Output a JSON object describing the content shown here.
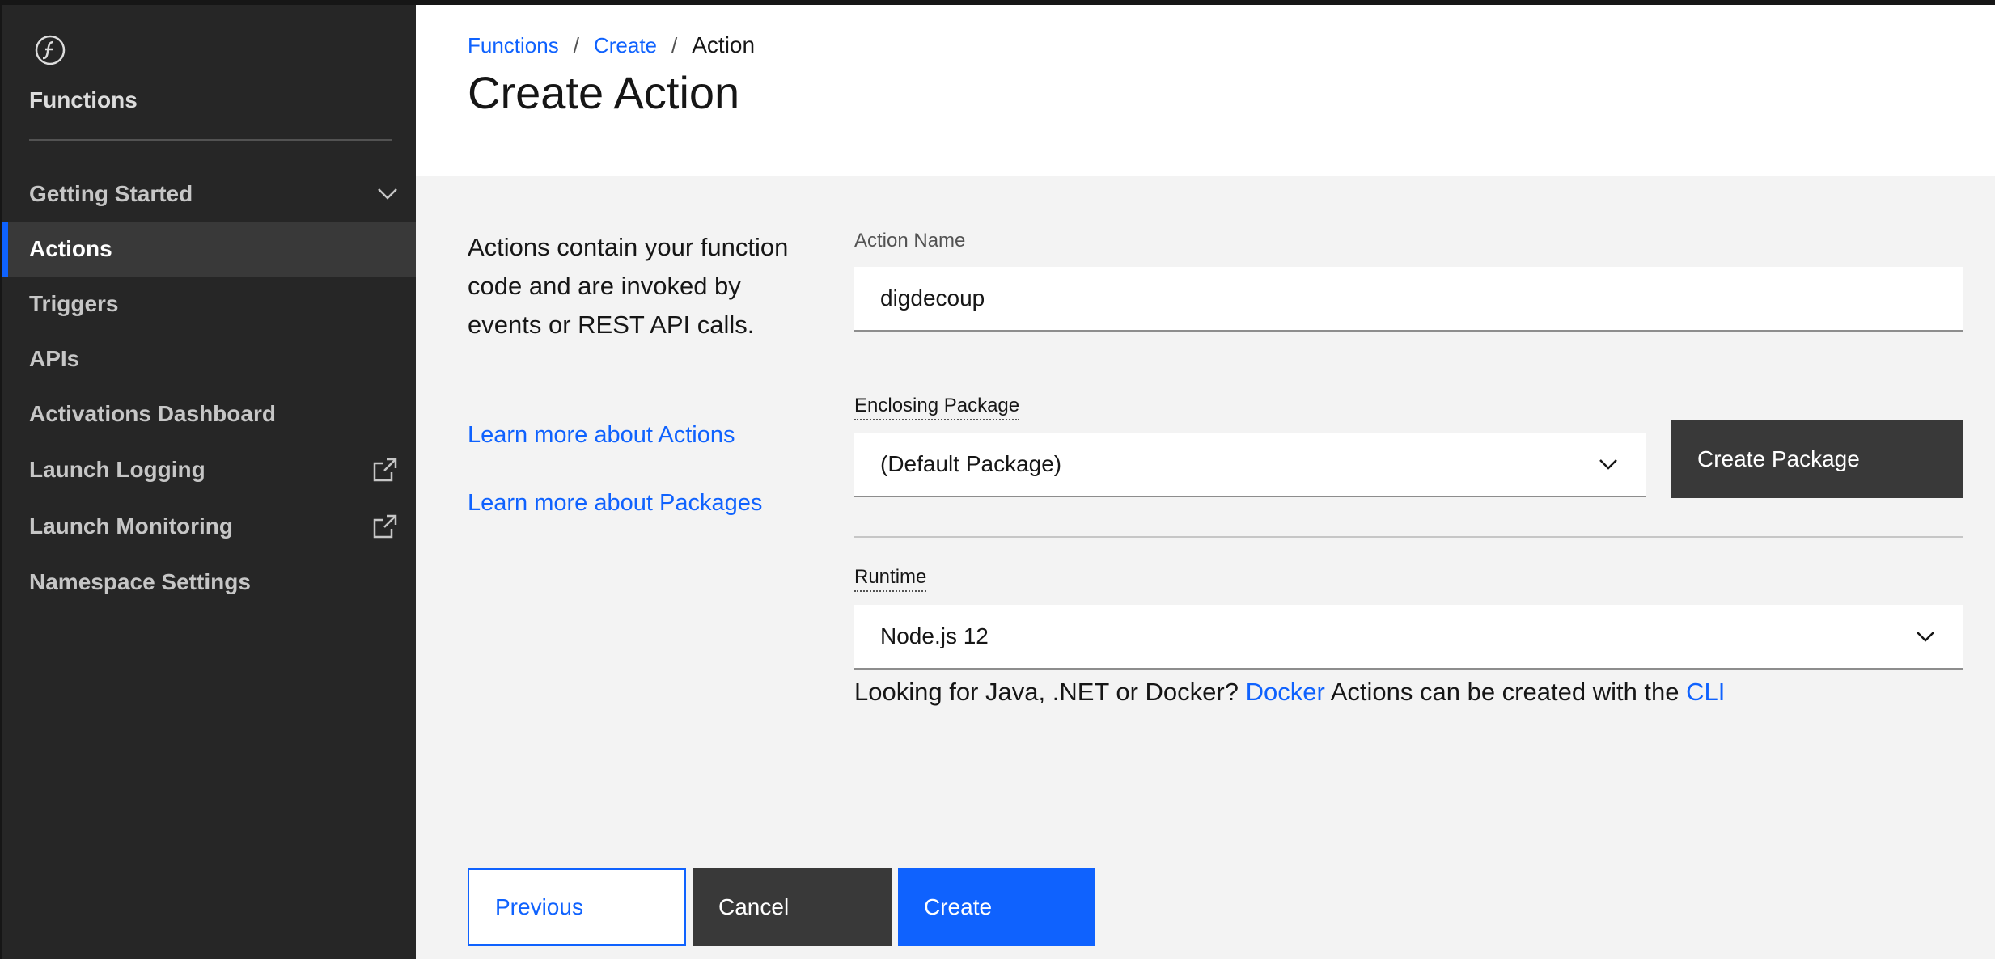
{
  "sidebar": {
    "app_name": "Functions",
    "items": [
      {
        "label": "Getting Started"
      },
      {
        "label": "Actions"
      },
      {
        "label": "Triggers"
      },
      {
        "label": "APIs"
      },
      {
        "label": "Activations Dashboard"
      },
      {
        "label": "Launch Logging"
      },
      {
        "label": "Launch Monitoring"
      },
      {
        "label": "Namespace Settings"
      }
    ]
  },
  "header": {
    "breadcrumb": [
      "Functions",
      "Create",
      "Action"
    ],
    "separator": "/",
    "title": "Create Action"
  },
  "intro": {
    "text": "Actions contain your function code and are invoked by events or REST API calls.",
    "link_actions": "Learn more about Actions",
    "link_packages": "Learn more about Packages"
  },
  "form": {
    "action_name": {
      "label": "Action Name",
      "value": "digdecoup"
    },
    "package": {
      "label": "Enclosing Package",
      "value": "(Default Package)",
      "create_button": "Create Package"
    },
    "runtime": {
      "label": "Runtime",
      "value": "Node.js 12"
    },
    "hint": {
      "prefix": "Looking for Java, .NET or Docker?",
      "docker_link": "Docker",
      "middle": "Actions can be created with the",
      "cli_link": "CLI"
    }
  },
  "footer": {
    "previous": "Previous",
    "cancel": "Cancel",
    "create": "Create"
  },
  "colors": {
    "accent": "#0f62fe",
    "sidebar_bg": "#262626",
    "sidebar_active": "#393939"
  }
}
